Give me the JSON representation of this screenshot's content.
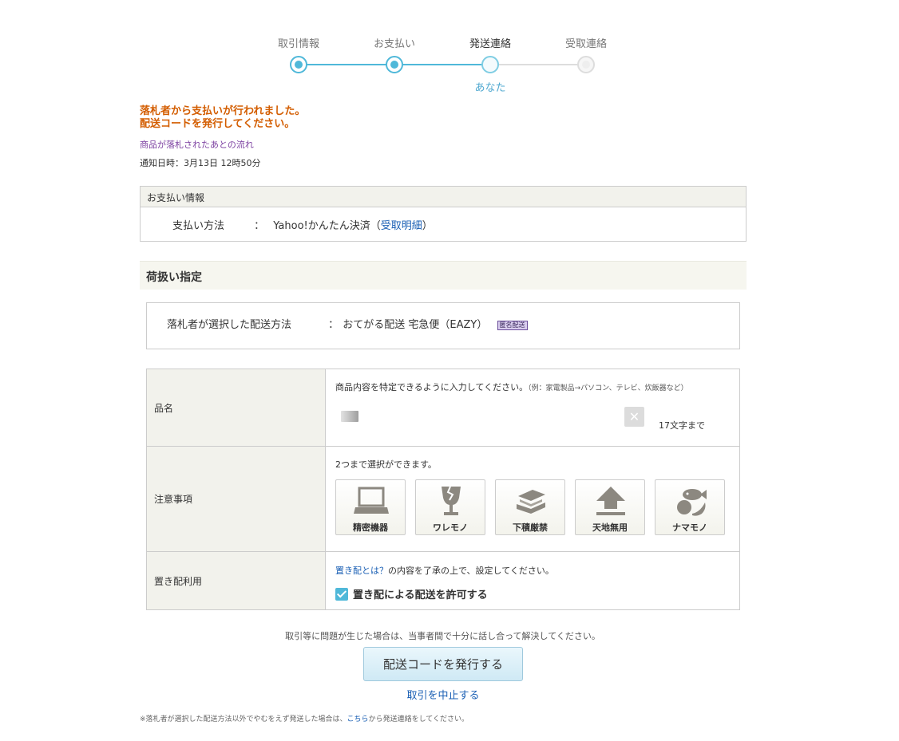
{
  "steps": [
    {
      "label": "取引情報",
      "state": "done"
    },
    {
      "label": "お支払い",
      "state": "done"
    },
    {
      "label": "発送連絡",
      "state": "current",
      "sub": "あなた"
    },
    {
      "label": "受取連絡",
      "state": "todo"
    }
  ],
  "notice": {
    "line1": "落札者から支払いが行われました。",
    "line2": "配送コードを発行してください。",
    "flow_link": "商品が落札されたあとの流れ",
    "date": "通知日時：3月13日 12時50分"
  },
  "payment": {
    "heading": "お支払い情報",
    "label": "支払い方法",
    "colon": "：",
    "value": "Yahoo!かんたん決済（",
    "link": "受取明細",
    "value_end": "）"
  },
  "section": {
    "title": "荷扱い指定"
  },
  "shipping": {
    "label": "落札者が選択した配送方法",
    "colon": "：",
    "value": "おてがる配送 宅急便（EAZY）",
    "badge": "匿名配送"
  },
  "item_name": {
    "label": "品名",
    "hint": "商品内容を特定できるように入力してください。",
    "hint_example": "（例：家電製品→パソコン、テレビ、炊飯器など）",
    "clear_symbol": "✕",
    "limit": "17文字まで"
  },
  "handling": {
    "label": "注意事項",
    "hint": "2つまで選択ができます。",
    "options": [
      {
        "label": "精密機器",
        "icon": "laptop-icon"
      },
      {
        "label": "ワレモノ",
        "icon": "broken-glass-icon"
      },
      {
        "label": "下積厳禁",
        "icon": "stack-icon"
      },
      {
        "label": "天地無用",
        "icon": "up-arrow-icon"
      },
      {
        "label": "ナマモノ",
        "icon": "perishable-food-icon"
      }
    ]
  },
  "okihai": {
    "label": "置き配利用",
    "link": "置き配とは？",
    "text": "の内容を了承の上で、設定してください。",
    "checkbox_label": "置き配による配送を許可する",
    "checked": true
  },
  "footer": {
    "caution": "取引等に問題が生じた場合は、当事者間で十分に話し合って解決してください。",
    "issue_button": "配送コードを発行する",
    "cancel_link": "取引を中止する",
    "footnote_pre": "※落札者が選択した配送方法以外でやむをえず発送した場合は、",
    "footnote_link": "こちら",
    "footnote_post": "から発送連絡をしてください。"
  },
  "colors": {
    "accent": "#4fb8d9",
    "notice": "#d35d00",
    "link": "#1a5fb4"
  }
}
